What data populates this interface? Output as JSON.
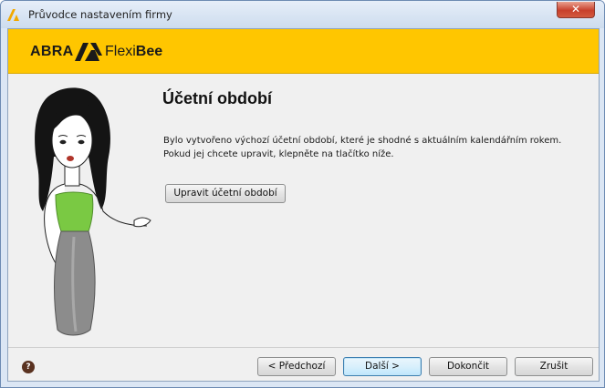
{
  "window": {
    "title": "Průvodce nastavením firmy",
    "close_label": "✕"
  },
  "brand": {
    "company": "ABRA",
    "product_light": "Flexi",
    "product_bold": "Bee",
    "color": "#ffc600"
  },
  "content": {
    "heading": "Účetní období",
    "line1": "Bylo vytvořeno výchozí účetní období, které je shodné s aktuálním kalendářním rokem.",
    "line2": "Pokud jej chcete upravit, klepněte na tlačítko níže.",
    "edit_button": "Upravit účetní období"
  },
  "footer": {
    "help_icon": "?",
    "prev": "< Předchozí",
    "next": "Další >",
    "finish": "Dokončit",
    "cancel": "Zrušit"
  }
}
